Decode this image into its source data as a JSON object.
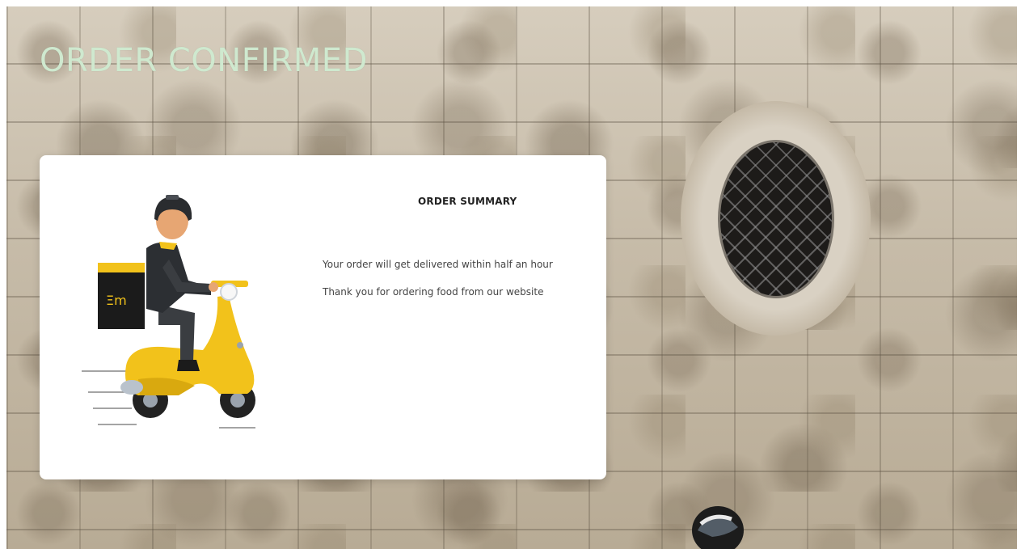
{
  "page": {
    "title": "ORDER CONFIRMED"
  },
  "summary": {
    "heading": "ORDER SUMMARY",
    "lines": [
      "Your order will get delivered within half an hour",
      "Thank you for ordering food from our website"
    ]
  },
  "illustration": {
    "subject": "delivery-scooter-rider",
    "box_logo": "Ξm"
  },
  "colors": {
    "title": "#cfe9cf",
    "scooter": "#f2c21b",
    "card": "#ffffff",
    "grate": "#1d1b19"
  }
}
